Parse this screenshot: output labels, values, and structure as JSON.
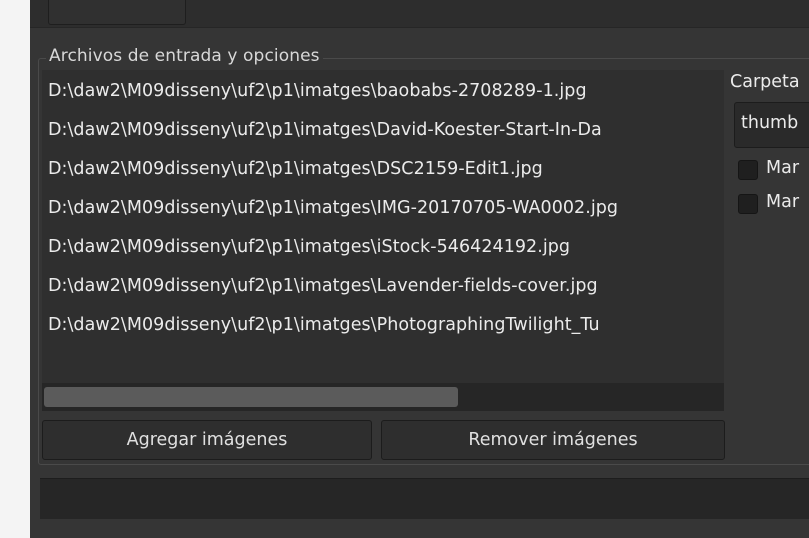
{
  "group": {
    "title": "Archivos de entrada y opciones"
  },
  "files": [
    "D:\\daw2\\M09disseny\\uf2\\p1\\imatges\\baobabs-2708289-1.jpg",
    "D:\\daw2\\M09disseny\\uf2\\p1\\imatges\\David-Koester-Start-In-Da",
    "D:\\daw2\\M09disseny\\uf2\\p1\\imatges\\DSC2159-Edit1.jpg",
    "D:\\daw2\\M09disseny\\uf2\\p1\\imatges\\IMG-20170705-WA0002.jpg",
    "D:\\daw2\\M09disseny\\uf2\\p1\\imatges\\iStock-546424192.jpg",
    "D:\\daw2\\M09disseny\\uf2\\p1\\imatges\\Lavender-fields-cover.jpg",
    "D:\\daw2\\M09disseny\\uf2\\p1\\imatges\\PhotographingTwilight_Tu"
  ],
  "options": {
    "folder_label": "Carpeta",
    "folder_value": "thumb",
    "checkbox_1": "Mar",
    "checkbox_2": "Mar"
  },
  "buttons": {
    "add": "Agregar imágenes",
    "remove": "Remover imágenes"
  },
  "scrollbar": {
    "visible_fraction": 0.61
  }
}
